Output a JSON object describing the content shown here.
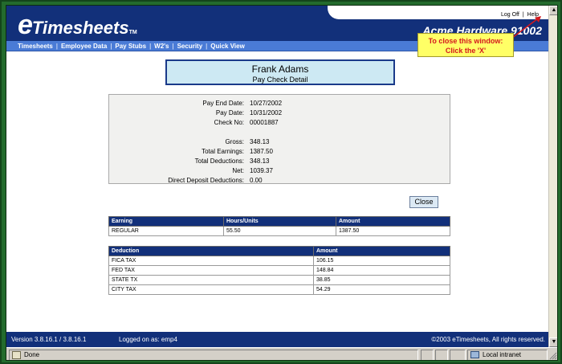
{
  "header": {
    "logo_e": "e",
    "logo_rest": "Timesheets",
    "logo_tm": "TM",
    "company": "Acme Hardware 91002",
    "logoff": "Log Off",
    "help": "Help",
    "separator": "|"
  },
  "nav": {
    "items": [
      "Timesheets",
      "Employee Data",
      "Pay Stubs",
      "W2's",
      "Security",
      "Quick View"
    ],
    "separator": "|"
  },
  "callout": {
    "line1": "To close this window:",
    "line2": "Click the 'X'"
  },
  "title": {
    "name": "Frank Adams",
    "subtitle": "Pay Check Detail"
  },
  "details": {
    "rows": [
      {
        "label": "Pay End Date:",
        "value": "10/27/2002"
      },
      {
        "label": "Pay Date:",
        "value": "10/31/2002"
      },
      {
        "label": "Check No:",
        "value": "00001887"
      },
      {
        "label": "Gross:",
        "value": "348.13"
      },
      {
        "label": "Total Earnings:",
        "value": "1387.50"
      },
      {
        "label": "Total Deductions:",
        "value": "348.13"
      },
      {
        "label": "Net:",
        "value": "1039.37"
      },
      {
        "label": "Direct Deposit Deductions:",
        "value": "0.00"
      }
    ]
  },
  "close_button": "Close",
  "earnings": {
    "headers": [
      "Earning",
      "Hours/Units",
      "Amount"
    ],
    "rows": [
      [
        "REGULAR",
        "55.50",
        "1387.50"
      ]
    ]
  },
  "deductions": {
    "headers": [
      "Deduction",
      "Amount"
    ],
    "rows": [
      [
        "FICA TAX",
        "106.15"
      ],
      [
        "FED TAX",
        "148.84"
      ],
      [
        "STATE TX",
        "38.85"
      ],
      [
        "CITY TAX",
        "54.29"
      ]
    ]
  },
  "footer": {
    "version": "Version 3.8.16.1 / 3.8.16.1",
    "logged_in": "Logged on as: emp4",
    "copyright": "©2003 eTimesheets, All rights reserved."
  },
  "status": {
    "done": "Done",
    "zone": "Local intranet"
  },
  "colors": {
    "brand_navy": "#12307a",
    "nav_blue": "#4a7bd6",
    "frame_green": "#236b2d",
    "callout_yellow": "#ffff66",
    "callout_red": "#d4181e",
    "title_box_bg": "#cde9f3"
  },
  "icons": {
    "scroll_up": "scroll-up-arrow-icon",
    "scroll_down": "scroll-down-arrow-icon",
    "page_done": "page-icon",
    "intranet": "intranet-zone-icon",
    "resize_grip": "resize-grip-icon"
  }
}
